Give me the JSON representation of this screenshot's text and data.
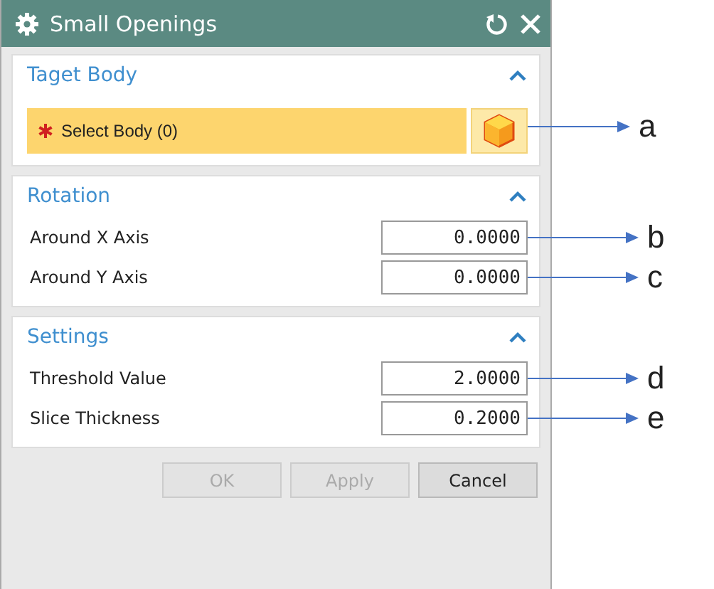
{
  "window": {
    "title": "Small Openings"
  },
  "sections": [
    {
      "title": "Taget Body",
      "expanded": true,
      "rows": [
        {
          "kind": "selection",
          "label": "Select Body (0)",
          "required": true,
          "callout": "a"
        }
      ]
    },
    {
      "title": "Rotation",
      "expanded": true,
      "rows": [
        {
          "kind": "number",
          "label": "Around X Axis",
          "value": "0.0000",
          "callout": "b"
        },
        {
          "kind": "number",
          "label": "Around Y Axis",
          "value": "0.0000",
          "callout": "c"
        }
      ]
    },
    {
      "title": "Settings",
      "expanded": true,
      "rows": [
        {
          "kind": "number",
          "label": "Threshold Value",
          "value": "2.0000",
          "callout": "d"
        },
        {
          "kind": "number",
          "label": "Slice Thickness",
          "value": "0.2000",
          "callout": "e"
        }
      ]
    }
  ],
  "buttons": [
    {
      "label": "OK",
      "disabled": true
    },
    {
      "label": "Apply",
      "disabled": true
    },
    {
      "label": "Cancel",
      "disabled": false
    }
  ]
}
